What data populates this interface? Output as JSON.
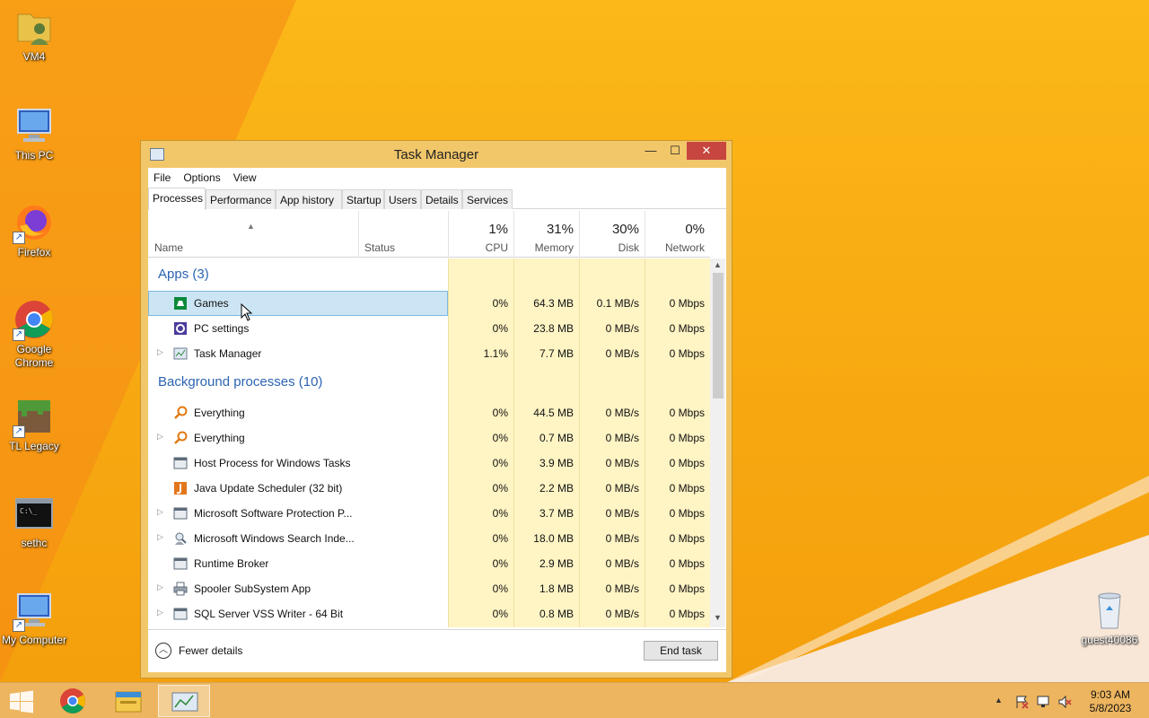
{
  "desktop": {
    "icons": [
      {
        "label": "VM4",
        "icon": "user-folder-icon"
      },
      {
        "label": "This PC",
        "icon": "computer-icon"
      },
      {
        "label": "Firefox",
        "icon": "firefox-icon"
      },
      {
        "label": "Google Chrome",
        "icon": "chrome-icon"
      },
      {
        "label": "TL Legacy",
        "icon": "minecraft-icon"
      },
      {
        "label": "sethc",
        "icon": "console-icon"
      },
      {
        "label": "My Computer",
        "icon": "computer-icon"
      },
      {
        "label": "guest40086",
        "icon": "recycle-bin-icon"
      }
    ]
  },
  "window": {
    "title": "Task Manager",
    "menu": [
      "File",
      "Options",
      "View"
    ],
    "tabs": [
      "Processes",
      "Performance",
      "App history",
      "Startup",
      "Users",
      "Details",
      "Services"
    ],
    "active_tab": "Processes",
    "columns": {
      "name": "Name",
      "status": "Status",
      "cpu": {
        "pct": "1%",
        "label": "CPU"
      },
      "memory": {
        "pct": "31%",
        "label": "Memory"
      },
      "disk": {
        "pct": "30%",
        "label": "Disk"
      },
      "network": {
        "pct": "0%",
        "label": "Network"
      }
    },
    "groups": {
      "apps": "Apps (3)",
      "background": "Background processes (10)"
    },
    "apps": [
      {
        "name": "Games",
        "cpu": "0%",
        "memory": "64.3 MB",
        "disk": "0.1 MB/s",
        "network": "0 Mbps",
        "icon": "games-icon",
        "expandable": false,
        "selected": true
      },
      {
        "name": "PC settings",
        "cpu": "0%",
        "memory": "23.8 MB",
        "disk": "0 MB/s",
        "network": "0 Mbps",
        "icon": "settings-gear-icon",
        "expandable": false
      },
      {
        "name": "Task Manager",
        "cpu": "1.1%",
        "memory": "7.7 MB",
        "disk": "0 MB/s",
        "network": "0 Mbps",
        "icon": "task-manager-icon",
        "expandable": true
      }
    ],
    "background": [
      {
        "name": "Everything",
        "cpu": "0%",
        "memory": "44.5 MB",
        "disk": "0 MB/s",
        "network": "0 Mbps",
        "icon": "magnifier-icon",
        "expandable": false
      },
      {
        "name": "Everything",
        "cpu": "0%",
        "memory": "0.7 MB",
        "disk": "0 MB/s",
        "network": "0 Mbps",
        "icon": "magnifier-icon",
        "expandable": true
      },
      {
        "name": "Host Process for Windows Tasks",
        "cpu": "0%",
        "memory": "3.9 MB",
        "disk": "0 MB/s",
        "network": "0 Mbps",
        "icon": "system-window-icon",
        "expandable": false
      },
      {
        "name": "Java Update Scheduler (32 bit)",
        "cpu": "0%",
        "memory": "2.2 MB",
        "disk": "0 MB/s",
        "network": "0 Mbps",
        "icon": "java-icon",
        "expandable": false
      },
      {
        "name": "Microsoft Software Protection P...",
        "cpu": "0%",
        "memory": "3.7 MB",
        "disk": "0 MB/s",
        "network": "0 Mbps",
        "icon": "system-window-icon",
        "expandable": true
      },
      {
        "name": "Microsoft Windows Search Inde...",
        "cpu": "0%",
        "memory": "18.0 MB",
        "disk": "0 MB/s",
        "network": "0 Mbps",
        "icon": "search-indexer-icon",
        "expandable": true
      },
      {
        "name": "Runtime Broker",
        "cpu": "0%",
        "memory": "2.9 MB",
        "disk": "0 MB/s",
        "network": "0 Mbps",
        "icon": "system-window-icon",
        "expandable": false
      },
      {
        "name": "Spooler SubSystem App",
        "cpu": "0%",
        "memory": "1.8 MB",
        "disk": "0 MB/s",
        "network": "0 Mbps",
        "icon": "printer-icon",
        "expandable": true
      },
      {
        "name": "SQL Server VSS Writer - 64 Bit",
        "cpu": "0%",
        "memory": "0.8 MB",
        "disk": "0 MB/s",
        "network": "0 Mbps",
        "icon": "system-window-icon",
        "expandable": true
      }
    ],
    "footer": {
      "fewer_details": "Fewer details",
      "end_task": "End task"
    }
  },
  "taskbar": {
    "pinned": [
      "start-icon",
      "chrome-icon",
      "file-explorer-icon",
      "task-manager-icon"
    ],
    "tray": [
      "show-hidden-icons-arrow",
      "action-center-flag-icon",
      "network-icon",
      "volume-muted-icon"
    ],
    "time": "9:03 AM",
    "date": "5/8/2023"
  },
  "colors": {
    "desktop": "#f8ab12",
    "selection": "#cce5f4",
    "group_header": "#2c64b3",
    "heatmap": "#fff4c4",
    "close_button": "#c7463f"
  }
}
